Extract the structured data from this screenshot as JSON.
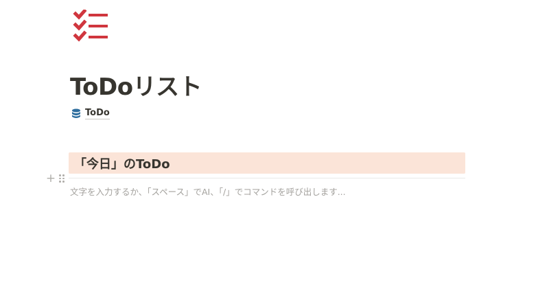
{
  "page": {
    "icon": "checklist-icon",
    "title": "ToDoリスト",
    "database_link": {
      "icon": "database-icon",
      "label": "ToDo"
    }
  },
  "blocks": {
    "heading": {
      "text": "「今日」のToDo",
      "background_color": "#fbe4d8"
    },
    "controls": {
      "add_icon": "plus-icon",
      "add_glyph": "+",
      "drag_icon": "drag-handle-icon"
    },
    "empty_block": {
      "placeholder": "文字を入力するか、「スペース」でAI、「/」でコマンドを呼び出します..."
    }
  },
  "colors": {
    "icon_red": "#d0363e",
    "text": "#37352f",
    "placeholder": "#a4a29e",
    "database_blue": "#2e6e9e"
  }
}
